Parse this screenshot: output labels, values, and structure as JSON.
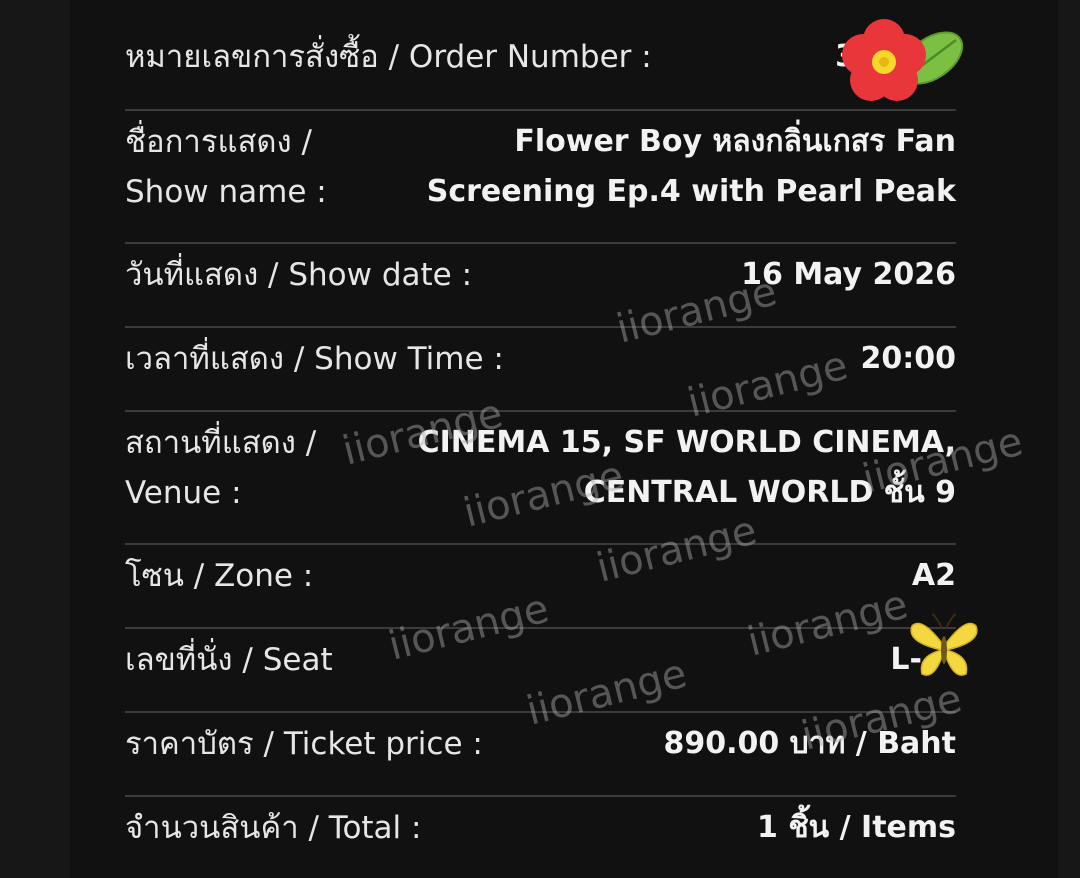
{
  "rows": [
    {
      "label": [
        "หมายเลขการสั่งซื้อ / Order Number :"
      ],
      "value": [
        "3"
      ]
    },
    {
      "label": [
        "ชื่อการแสดง /",
        "Show name :"
      ],
      "value": [
        "Flower Boy หลงกลิ่นเกสร Fan",
        "Screening Ep.4 with Pearl Peak"
      ]
    },
    {
      "label": [
        "วันที่แสดง / Show date :"
      ],
      "value": [
        "16 May 2026"
      ]
    },
    {
      "label": [
        "เวลาที่แสดง / Show Time :"
      ],
      "value": [
        "20:00"
      ]
    },
    {
      "label": [
        "สถานที่แสดง /",
        "Venue :"
      ],
      "value": [
        "CINEMA 15, SF WORLD CINEMA,",
        "CENTRAL WORLD ชั้น 9"
      ]
    },
    {
      "label": [
        "โซน / Zone :"
      ],
      "value": [
        "A2"
      ]
    },
    {
      "label": [
        "เลขที่นั่ง / Seat"
      ],
      "value": [
        "L-"
      ]
    },
    {
      "label": [
        "ราคาบัตร / Ticket price :"
      ],
      "value": [
        "890.00 บาท / Baht"
      ]
    },
    {
      "label": [
        "จำนวนสินค้า / Total :"
      ],
      "value": [
        "1 ชิ้น / Items"
      ]
    }
  ],
  "watermark": "iiorange",
  "stickers": [
    "flower-sticker",
    "butterfly-sticker"
  ]
}
